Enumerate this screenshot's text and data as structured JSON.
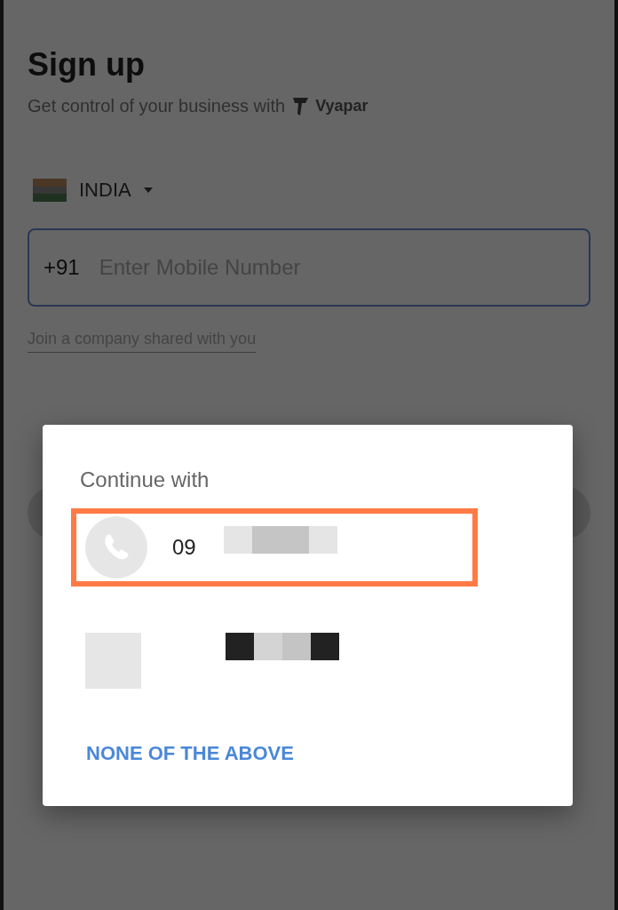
{
  "page": {
    "title": "Sign up",
    "subtitle": "Get control of your business with",
    "brand": "Vyapar",
    "country": "INDIA",
    "phone_field": {
      "prefix": "+91",
      "placeholder": "Enter Mobile Number"
    },
    "join_link": "Join a company shared with you"
  },
  "dialog": {
    "title": "Continue with",
    "options": [
      {
        "kind": "phone",
        "number": "09",
        "highlighted": true
      },
      {
        "kind": "account",
        "highlighted": false
      }
    ],
    "dismiss": "NONE OF THE ABOVE"
  }
}
